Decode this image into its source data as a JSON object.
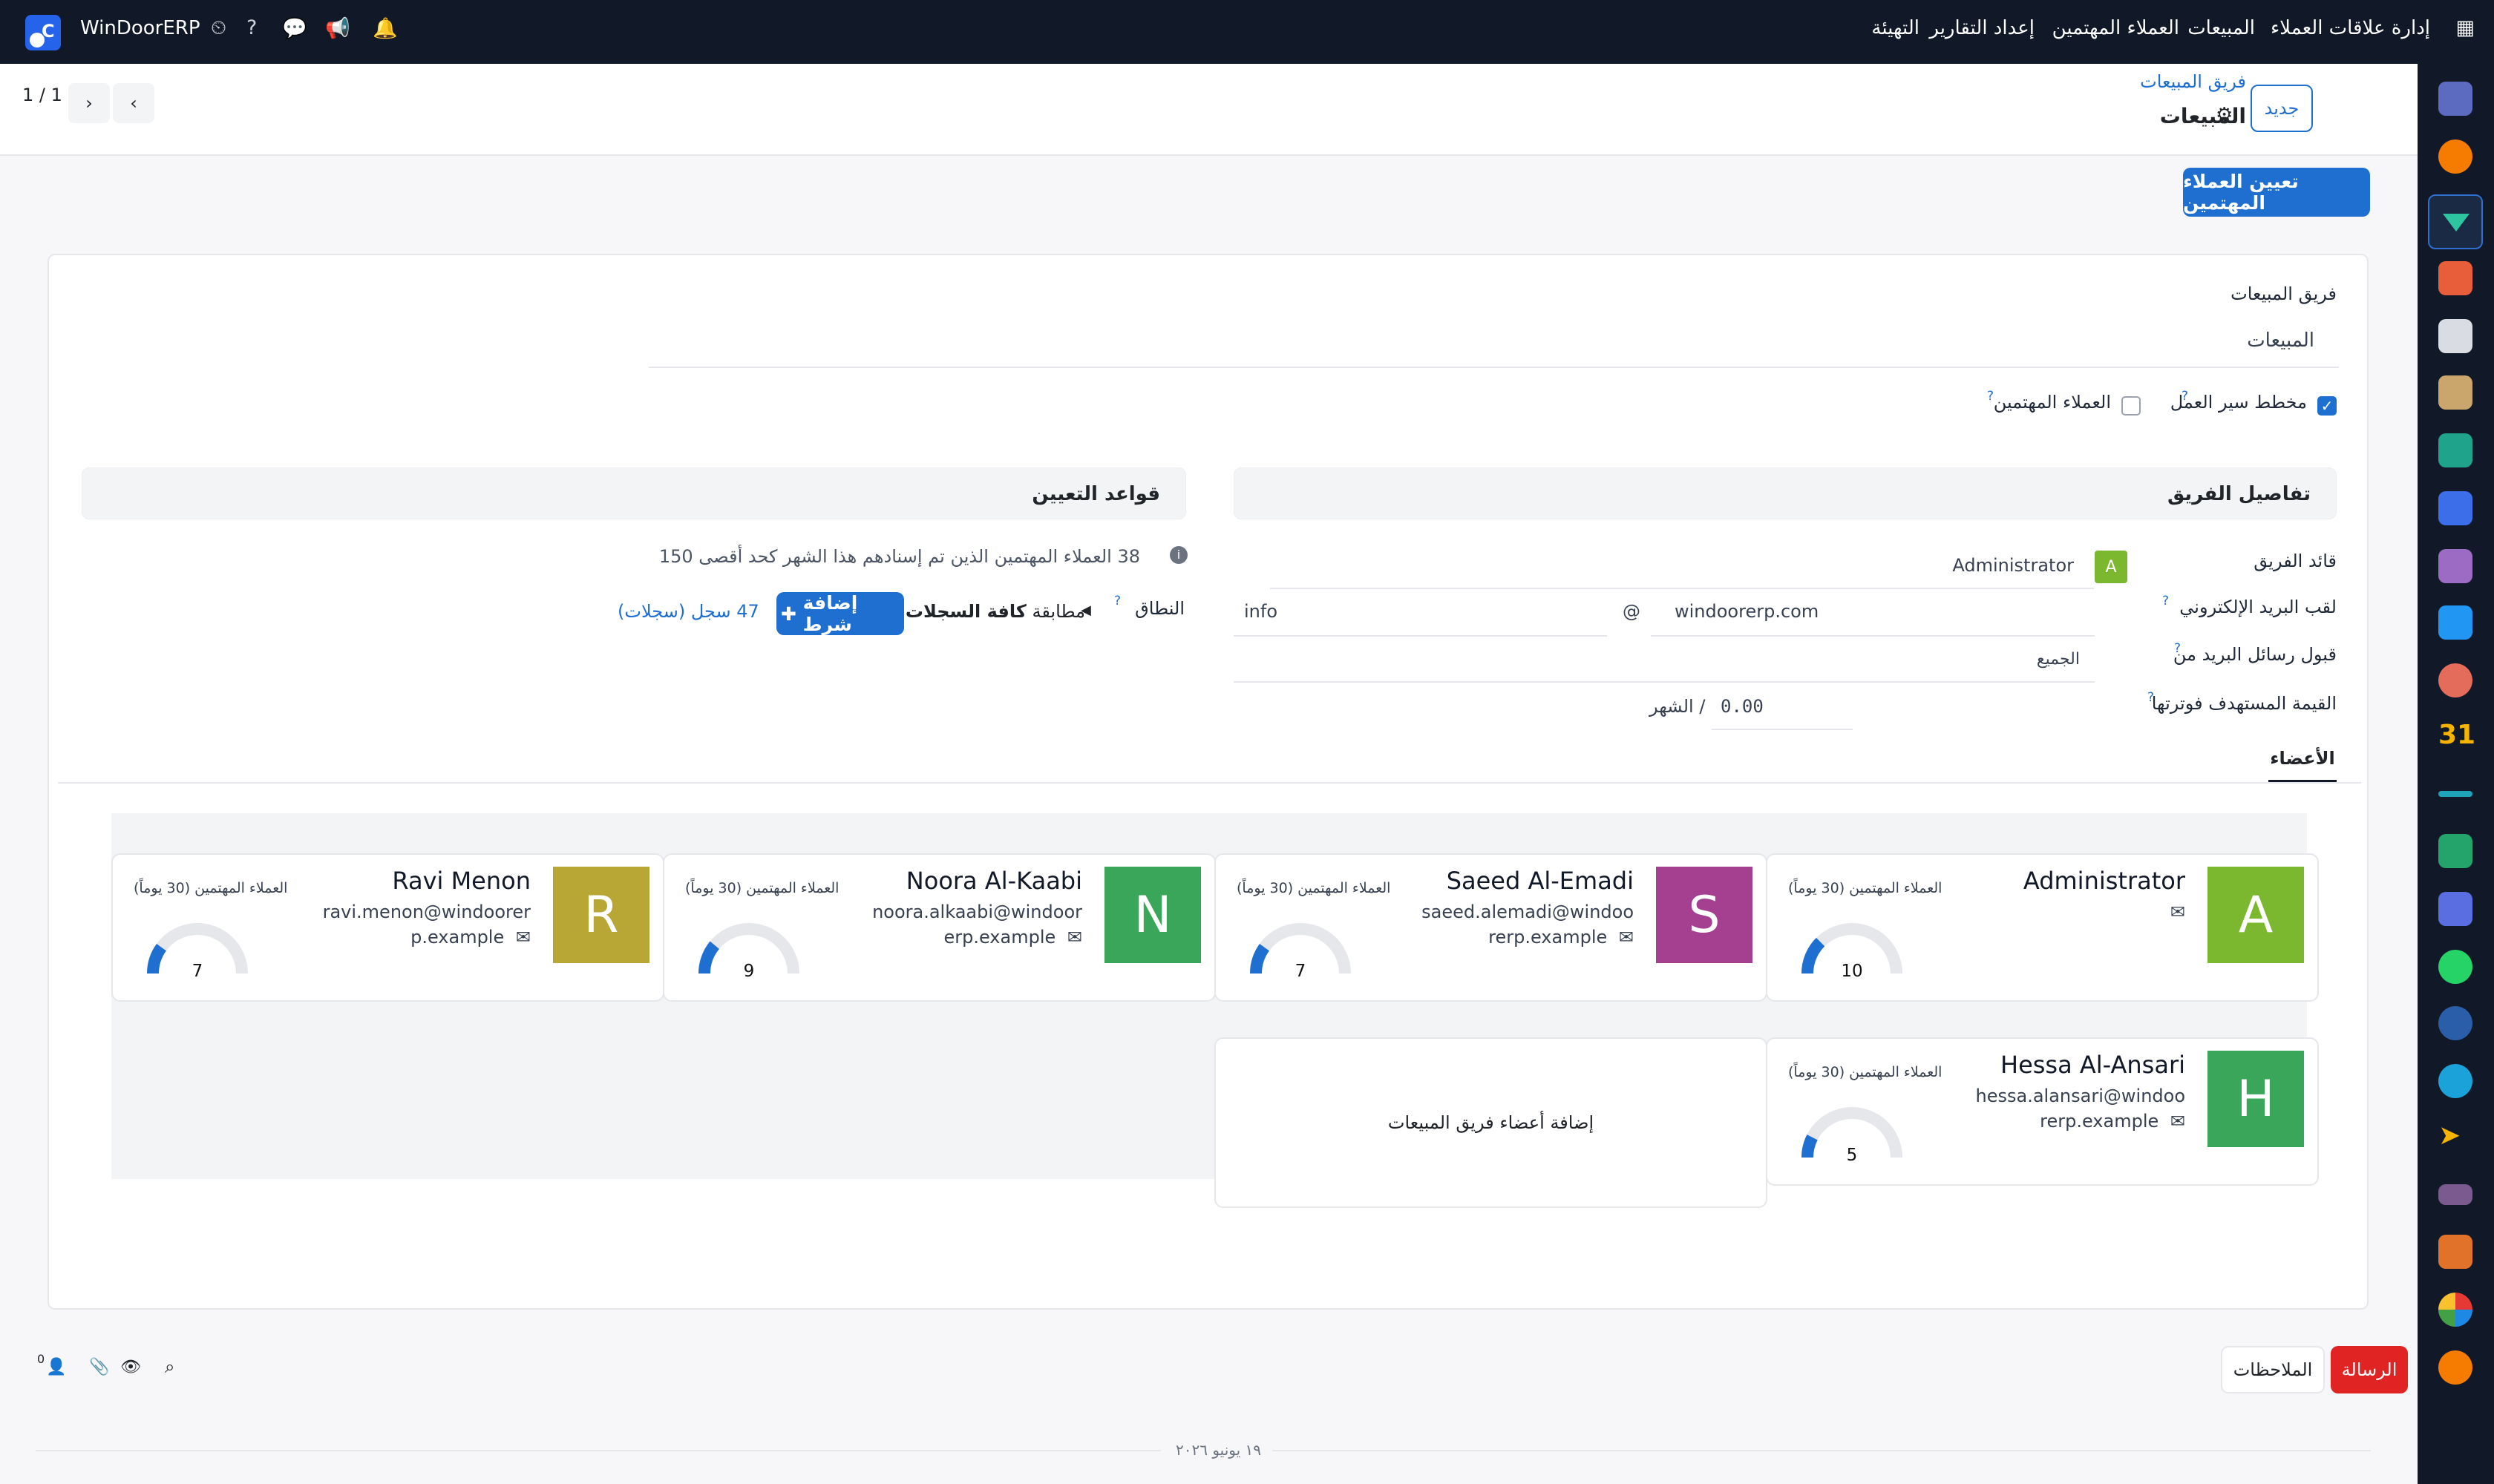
{
  "topbar": {
    "brand": "WinDoorERP",
    "app_name": "إدارة علاقات العملاء",
    "menu": [
      "المبيعات",
      "العملاء المهتمين",
      "إعداد التقارير",
      "التهيئة"
    ]
  },
  "breadcrumb": {
    "parent": "فريق المبيعات",
    "current": "المبيعات"
  },
  "actions": {
    "new": "جديد",
    "assign": "تعيين العملاء المهتمين"
  },
  "pager": {
    "value": "1 / 1"
  },
  "form": {
    "team_label": "فريق المبيعات",
    "team_value": "المبيعات",
    "pipeline_label": "مخطط سير العمل",
    "pipeline_checked": true,
    "leads_label": "العملاء المهتمين",
    "leads_checked": false,
    "details_title": "تفاصيل الفريق",
    "leader_label": "قائد الفريق",
    "leader_value": "Administrator",
    "leader_initial": "A",
    "alias_label": "لقب البريد الإلكتروني",
    "alias_name": "info",
    "alias_at": "@",
    "alias_domain": "windoorerp.com",
    "accept_label": "قبول رسائل البريد من",
    "accept_value": "الجميع",
    "target_label": "القيمة المستهدف فوترتها",
    "target_value": "0.00",
    "target_unit": "/ الشهر",
    "rules_title": "قواعد التعيين",
    "capacity_text": "38 العملاء المهتمين الذين تم إسنادهم هذا الشهر كحد أقصى 150",
    "domain_label": "النطاق",
    "match_text": "مطابقة",
    "match_all": "كافة السجلات",
    "add_condition": "إضافة شرط",
    "records": "47 سجل (سجلات)"
  },
  "tabs": {
    "members": "الأعضاء"
  },
  "members": [
    {
      "initial": "A",
      "name": "Administrator",
      "email": "",
      "leads_label": "العملاء المهتمين (30 يوماً)",
      "count": "10",
      "color": "#7cb82f",
      "fill": 0.25
    },
    {
      "initial": "S",
      "name": "Saeed Al-Emadi",
      "email": "saeed.alemadi@windoorerp.example",
      "leads_label": "العملاء المهتمين (30 يوماً)",
      "count": "7",
      "color": "#a4408f",
      "fill": 0.2
    },
    {
      "initial": "N",
      "name": "Noora Al-Kaabi",
      "email": "noora.alkaabi@windoorerp.example",
      "leads_label": "العملاء المهتمين (30 يوماً)",
      "count": "9",
      "color": "#3aa659",
      "fill": 0.22
    },
    {
      "initial": "R",
      "name": "Ravi Menon",
      "email": "ravi.menon@windoorerp.example",
      "leads_label": "العملاء المهتمين (30 يوماً)",
      "count": "7",
      "color": "#b8a635",
      "fill": 0.2
    },
    {
      "initial": "H",
      "name": "Hessa Al-Ansari",
      "email": "hessa.alansari@windoorerp.example",
      "leads_label": "العملاء المهتمين (30 يوماً)",
      "count": "5",
      "color": "#3aa659",
      "fill": 0.15
    }
  ],
  "add_member": "إضافة أعضاء فريق المبيعات",
  "chatter": {
    "send_message": "الرسالة",
    "log_note": "الملاحظات",
    "followers": "0",
    "date": "١٩ يونيو ٢٠٢٦"
  }
}
